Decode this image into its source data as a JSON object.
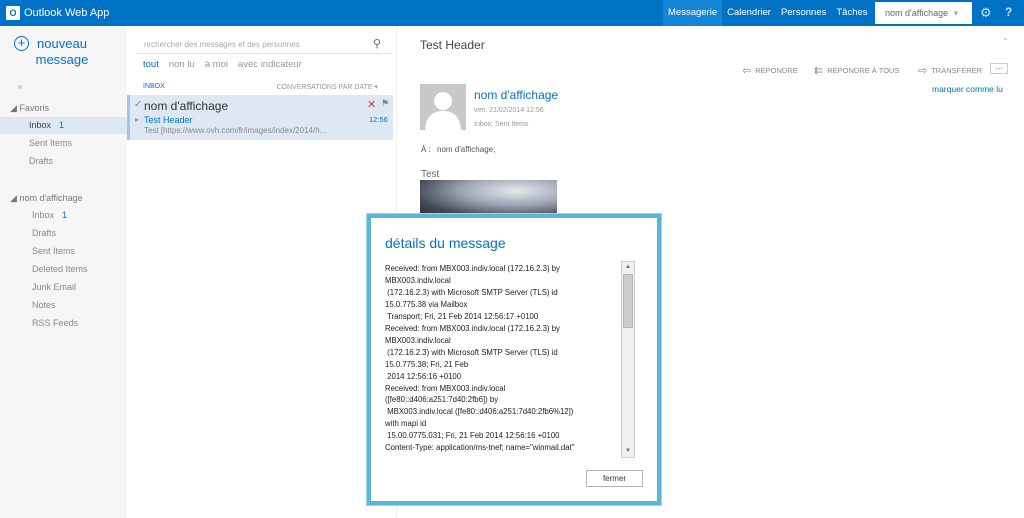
{
  "app": {
    "title": "Outlook Web App",
    "logo_letters": "O"
  },
  "topnav": {
    "items": [
      "Messagerie",
      "Calendrier",
      "Personnes",
      "Tâches"
    ],
    "user": "nom d'affichage",
    "user_arrow": "▾"
  },
  "leftnav": {
    "new_label": "nouveau message",
    "collapse": "«",
    "favorites": {
      "header": "Favoris",
      "items": [
        {
          "label": "Inbox",
          "count": "1"
        },
        {
          "label": "Sent Items"
        },
        {
          "label": "Drafts"
        }
      ]
    },
    "mailbox": {
      "header": "nom d'affichage",
      "items": [
        {
          "label": "Inbox",
          "count": "1"
        },
        {
          "label": "Drafts"
        },
        {
          "label": "Sent Items"
        },
        {
          "label": "Deleted Items"
        },
        {
          "label": "Junk Email"
        },
        {
          "label": "Notes"
        },
        {
          "label": "RSS Feeds"
        }
      ]
    }
  },
  "list": {
    "search_placeholder": "rechercher des messages et des personnes",
    "filters": [
      "tout",
      "non lu",
      "à moi",
      "avec indicateur"
    ],
    "folder": "INBOX",
    "sort": "CONVERSATIONS PAR DATE ▾",
    "message": {
      "from": "nom d'affichage",
      "subject": "Test Header",
      "preview": "Test [https://www.ovh.com/fr/images/index/2014/h...",
      "time": "12:56"
    }
  },
  "reading": {
    "title": "Test Header",
    "actions": {
      "reply": "RÉPONDRE",
      "reply_all": "RÉPONDRE À TOUS",
      "forward": "TRANSFÉRER",
      "more": "..."
    },
    "sender": "nom d'affichage",
    "sent": "ven. 21/02/2014 12:56",
    "folder": "Inbox; Sent Items",
    "mark_read": "marquer comme lu",
    "to_label": "À :",
    "to_value": "nom d'affichage;",
    "body": "Test"
  },
  "dialog": {
    "title": "détails du message",
    "header_text": "Received: from MBX003.indiv.local (172.16.2.3) by\nMBX003.indiv.local\n (172.16.2.3) with Microsoft SMTP Server (TLS) id\n15.0.775.38 via Mailbox\n Transport; Fri, 21 Feb 2014 12:56:17 +0100\nReceived: from MBX003.indiv.local (172.16.2.3) by\nMBX003.indiv.local\n (172.16.2.3) with Microsoft SMTP Server (TLS) id\n15.0.775.38; Fri, 21 Feb\n 2014 12:56:16 +0100\nReceived: from MBX003.indiv.local\n([fe80::d406:a251:7d40:2fb6]) by\n MBX003.indiv.local ([fe80::d406:a251:7d40:2fb6%12])\nwith mapi id\n 15.00.0775.031; Fri, 21 Feb 2014 12:56:16 +0100\nContent-Type: application/ms-tnef; name=\"winmail.dat\"\nContent-Transfer-Encoding: binary",
    "close_label": "fermer"
  }
}
